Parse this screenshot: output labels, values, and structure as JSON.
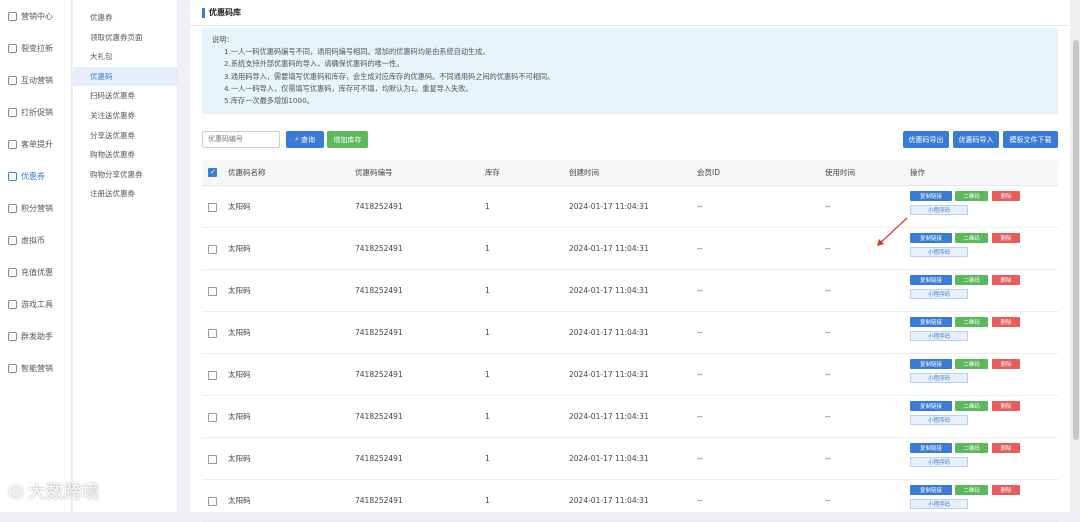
{
  "sidebar": {
    "items": [
      {
        "label": "营销中心",
        "active": false
      },
      {
        "label": "裂变拉新",
        "active": false
      },
      {
        "label": "互动营销",
        "active": false
      },
      {
        "label": "打折促销",
        "active": false
      },
      {
        "label": "客单提升",
        "active": false
      },
      {
        "label": "优惠券",
        "active": true
      },
      {
        "label": "积分营销",
        "active": false
      },
      {
        "label": "虚拟币",
        "active": false
      },
      {
        "label": "充值优惠",
        "active": false
      },
      {
        "label": "游戏工具",
        "active": false
      },
      {
        "label": "群发助手",
        "active": false
      },
      {
        "label": "智能营销",
        "active": false
      }
    ]
  },
  "submenu": {
    "items": [
      {
        "label": "优惠券"
      },
      {
        "label": "领取优惠券页面"
      },
      {
        "label": "大礼包"
      },
      {
        "label": "优惠码",
        "active": true
      },
      {
        "label": "扫码送优惠券"
      },
      {
        "label": "关注送优惠券"
      },
      {
        "label": "分享送优惠券"
      },
      {
        "label": "购物送优惠券"
      },
      {
        "label": "购物分享优惠券"
      },
      {
        "label": "注册送优惠券"
      }
    ]
  },
  "page": {
    "title": "优惠码库"
  },
  "note": {
    "header": "说明：",
    "lines": [
      "1.一人一码优惠码编号不同，通用码编号相同。增加的优惠码均是由系统自动生成。",
      "2.系统支持外部优惠码的导入，请确保优惠码的唯一性。",
      "3.通用码导入，需要填写优惠码和库存，会生成对应库存的优惠码。不同通用码之间的优惠码不可相同。",
      "4.一人一码导入，仅需填写优惠码，库存可不填，均默认为1。重复导入失败。",
      "5.库存一次最多增加1000。"
    ]
  },
  "toolbar": {
    "search_placeholder": "优惠码编号",
    "query_label": "查询",
    "add_stock_label": "增加库存",
    "export_label": "优惠码导出",
    "import_label": "优惠码导入",
    "template_label": "模板文件下载"
  },
  "table": {
    "headers": [
      "优惠码名称",
      "优惠码编号",
      "库存",
      "创建时间",
      "会员ID",
      "使用时间",
      "操作"
    ],
    "rows": [
      {
        "name": "太阳码",
        "code": "7418252491",
        "stock": "1",
        "created": "2024-01-17 11:04:31",
        "member": "--",
        "used": "--"
      },
      {
        "name": "太阳码",
        "code": "7418252491",
        "stock": "1",
        "created": "2024-01-17 11:04:31",
        "member": "--",
        "used": "--"
      },
      {
        "name": "太阳码",
        "code": "7418252491",
        "stock": "1",
        "created": "2024-01-17 11:04:31",
        "member": "--",
        "used": "--"
      },
      {
        "name": "太阳码",
        "code": "7418252491",
        "stock": "1",
        "created": "2024-01-17 11:04:31",
        "member": "--",
        "used": "--"
      },
      {
        "name": "太阳码",
        "code": "7418252491",
        "stock": "1",
        "created": "2024-01-17 11:04:31",
        "member": "--",
        "used": "--"
      },
      {
        "name": "太阳码",
        "code": "7418252491",
        "stock": "1",
        "created": "2024-01-17 11:04:31",
        "member": "--",
        "used": "--"
      },
      {
        "name": "太阳码",
        "code": "7418252491",
        "stock": "1",
        "created": "2024-01-17 11:04:31",
        "member": "--",
        "used": "--"
      },
      {
        "name": "太阳码",
        "code": "7418252491",
        "stock": "1",
        "created": "2024-01-17 11:04:31",
        "member": "--",
        "used": "--"
      }
    ],
    "ops": {
      "copy": "复制链接",
      "qr": "二维码",
      "del": "删除",
      "mini": "小程序码"
    }
  },
  "watermark": {
    "text": "大数跨境"
  },
  "colors": {
    "accent": "#3a7bd5",
    "green": "#5cb85c",
    "red": "#e85c5c",
    "note_bg": "#e8f4fb"
  }
}
